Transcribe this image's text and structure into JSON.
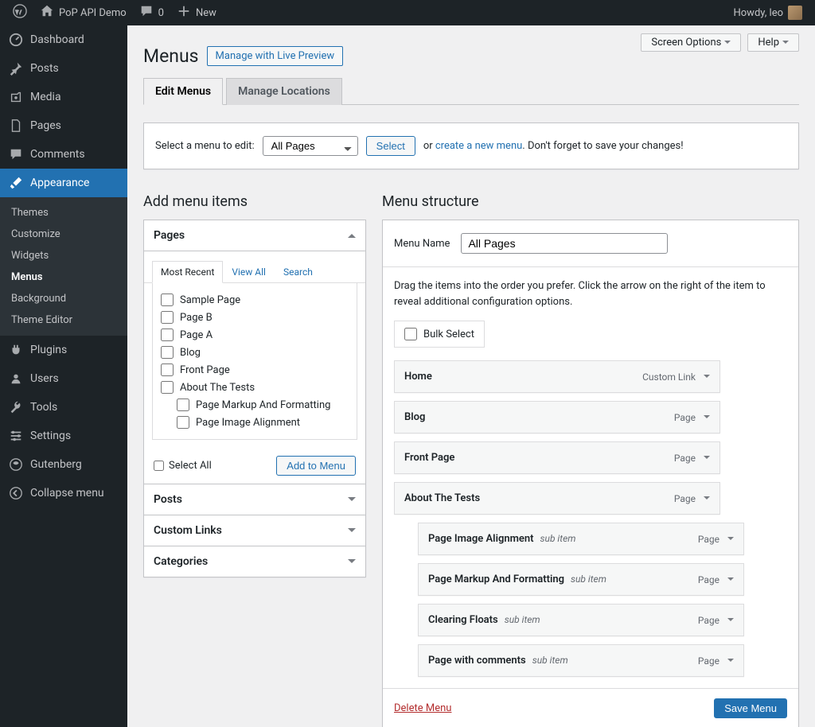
{
  "adminbar": {
    "site_name": "PoP API Demo",
    "comments_count": "0",
    "new_label": "New",
    "greeting": "Howdy, leo"
  },
  "sidebar": {
    "items": [
      {
        "label": "Dashboard"
      },
      {
        "label": "Posts"
      },
      {
        "label": "Media"
      },
      {
        "label": "Pages"
      },
      {
        "label": "Comments"
      },
      {
        "label": "Appearance"
      },
      {
        "label": "Plugins"
      },
      {
        "label": "Users"
      },
      {
        "label": "Tools"
      },
      {
        "label": "Settings"
      },
      {
        "label": "Gutenberg"
      },
      {
        "label": "Collapse menu"
      }
    ],
    "appearance_submenu": [
      {
        "label": "Themes"
      },
      {
        "label": "Customize"
      },
      {
        "label": "Widgets"
      },
      {
        "label": "Menus"
      },
      {
        "label": "Background"
      },
      {
        "label": "Theme Editor"
      }
    ]
  },
  "main": {
    "screen_options": "Screen Options",
    "help": "Help",
    "page_title": "Menus",
    "page_action": "Manage with Live Preview",
    "tab_edit": "Edit Menus",
    "tab_locations": "Manage Locations",
    "select_label": "Select a menu to edit:",
    "select_value": "All Pages",
    "select_button": "Select",
    "or_text": "or ",
    "create_link": "create a new menu",
    "dont_forget": ". Don't forget to save your changes!"
  },
  "left_col": {
    "heading": "Add menu items",
    "box_pages": "Pages",
    "box_posts": "Posts",
    "box_links": "Custom Links",
    "box_categories": "Categories",
    "tab_recent": "Most Recent",
    "tab_view_all": "View All",
    "tab_search": "Search",
    "pages": [
      {
        "label": "Sample Page"
      },
      {
        "label": "Page B"
      },
      {
        "label": "Page A"
      },
      {
        "label": "Blog"
      },
      {
        "label": "Front Page"
      },
      {
        "label": "About The Tests"
      },
      {
        "label": "Page Markup And Formatting",
        "indent": true
      },
      {
        "label": "Page Image Alignment",
        "indent": true
      }
    ],
    "select_all": "Select All",
    "add_to_menu": "Add to Menu"
  },
  "right_col": {
    "heading": "Menu structure",
    "menu_name_label": "Menu Name",
    "menu_name_value": "All Pages",
    "instruction": "Drag the items into the order you prefer. Click the arrow on the right of the item to reveal additional configuration options.",
    "bulk_select": "Bulk Select",
    "items": [
      {
        "title": "Home",
        "type": "Custom Link",
        "sub": false,
        "indent": false
      },
      {
        "title": "Blog",
        "type": "Page",
        "sub": false,
        "indent": false
      },
      {
        "title": "Front Page",
        "type": "Page",
        "sub": false,
        "indent": false
      },
      {
        "title": "About The Tests",
        "type": "Page",
        "sub": false,
        "indent": false
      },
      {
        "title": "Page Image Alignment",
        "type": "Page",
        "sub": true,
        "indent": true
      },
      {
        "title": "Page Markup And Formatting",
        "type": "Page",
        "sub": true,
        "indent": true
      },
      {
        "title": "Clearing Floats",
        "type": "Page",
        "sub": true,
        "indent": true
      },
      {
        "title": "Page with comments",
        "type": "Page",
        "sub": true,
        "indent": true
      }
    ],
    "sub_item_label": "sub item",
    "delete_menu": "Delete Menu",
    "save_menu": "Save Menu"
  }
}
